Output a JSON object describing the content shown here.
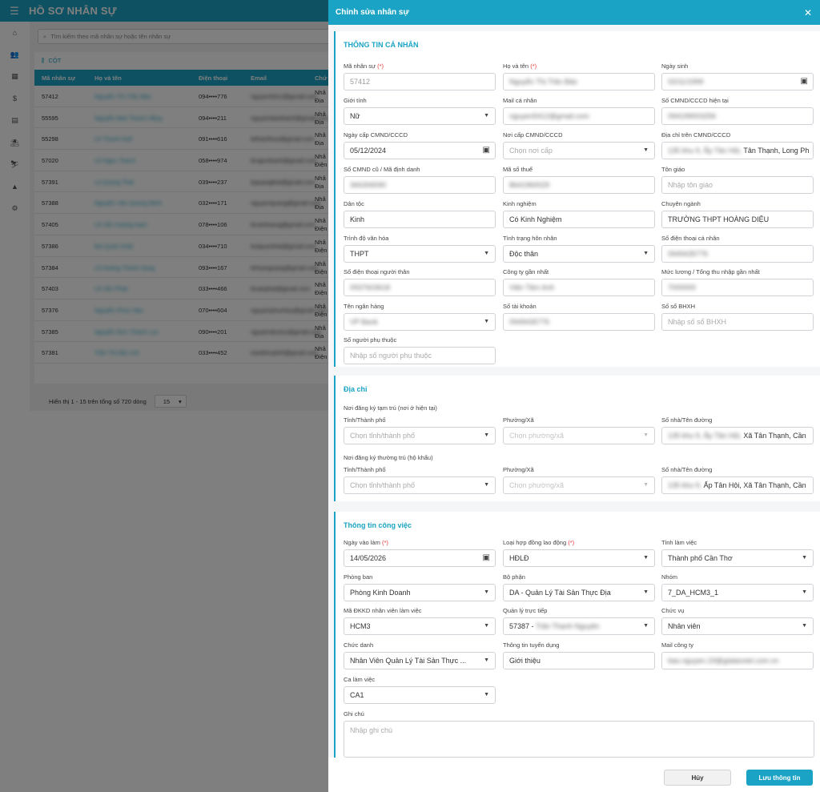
{
  "app": {
    "title": "HỒ SƠ NHÂN SỰ",
    "search_placeholder": "Tìm kiếm theo mã nhân sự hoặc tên nhân sự",
    "columns_button": "CỘT",
    "table": {
      "headers": [
        "Mã nhân sự",
        "Họ và tên",
        "Điện thoại",
        "Email",
        "Chứ"
      ],
      "rows": [
        {
          "code": "57412",
          "name": "Nguyễn Thị Trần Bảo",
          "phone": "094••••776",
          "email": "nguyen5412@gmail.com",
          "cat": [
            "Nhâ",
            "Địa"
          ]
        },
        {
          "code": "55595",
          "name": "Nguyễn Bảo Thanh Hằng",
          "phone": "094••••211",
          "email": "nguyenbaothanh@gmail.com",
          "cat": [
            "Nhâ",
            "Địa"
          ]
        },
        {
          "code": "55298",
          "name": "Lê Thanh Huệ",
          "phone": "091••••616",
          "email": "lethanhhue@gmail.com",
          "cat": [
            "Nhâ",
            "Địa"
          ]
        },
        {
          "code": "57020",
          "name": "Lê Ngọc Thanh",
          "phone": "058••••974",
          "email": "lengocthanh@gmail.com",
          "cat": [
            "Nhâ",
            "Điện"
          ]
        },
        {
          "code": "57391",
          "name": "Lý Quang Thái",
          "phone": "039••••237",
          "email": "lyquangthai@gmail.com",
          "cat": [
            "Nhâ",
            "Địa"
          ]
        },
        {
          "code": "57388",
          "name": "Nguyễn Văn Quang Minh",
          "phone": "032••••171",
          "email": "nguyenquang@gmail.com",
          "cat": [
            "Nhâ",
            "Địa"
          ]
        },
        {
          "code": "57405",
          "name": "Lê Văn Hoàng Nam",
          "phone": "078••••106",
          "email": "levanhoang@gmail.com",
          "cat": [
            "Nhâ",
            "Điện"
          ]
        },
        {
          "code": "57386",
          "name": "Bùi Quốc Khải",
          "phone": "034••••710",
          "email": "buiquockhai@gmail.com",
          "cat": [
            "Nhâ",
            "Điện"
          ]
        },
        {
          "code": "57384",
          "name": "Lê Hoàng Thanh Sang",
          "phone": "093••••167",
          "email": "lehoangsang@gmail.com",
          "cat": [
            "Nhâ",
            "Điện"
          ]
        },
        {
          "code": "57403",
          "name": "Lê Văn Phát",
          "phone": "033••••466",
          "email": "levanphat@gmail.com",
          "cat": [
            "Nhâ",
            "Điện"
          ]
        },
        {
          "code": "57376",
          "name": "Nguyễn Phúc Hậu",
          "phone": "070••••604",
          "email": "nguyenphuchau@gmail.com",
          "cat": [
            "Nhâ",
            "Điện"
          ]
        },
        {
          "code": "57385",
          "name": "Nguyễn Đức Thành Lực",
          "phone": "090••••201",
          "email": "nguyenducluc@gmail.com",
          "cat": [
            "Nhâ",
            "Địa"
          ]
        },
        {
          "code": "57381",
          "name": "Trần Thị Mỹ Linh",
          "phone": "033••••452",
          "email": "tranthimylinh@gmail.com",
          "cat": [
            "Nhâ",
            "Điện"
          ]
        }
      ]
    },
    "footer_text": "Hiển thị 1 - 15 trên tổng số 720 dòng",
    "page_size": "15"
  },
  "drawer": {
    "title": "Chỉnh sửa nhân sự",
    "personal": {
      "title": "THÔNG TIN CÁ NHÂN",
      "employee_code": {
        "label": "Mã nhân sự",
        "value": "57412"
      },
      "full_name": {
        "label": "Họ và tên",
        "value": "Nguyễn Thị Trần Bảo"
      },
      "birthday": {
        "label": "Ngày sinh",
        "value": "02/11/1999"
      },
      "gender": {
        "label": "Giới tính",
        "value": "Nữ"
      },
      "personal_mail": {
        "label": "Mail cá nhân",
        "value": "nguyen5412@gmail.com"
      },
      "id_current": {
        "label": "Số CMND/CCCD hiện tại",
        "value": "094199003256"
      },
      "id_issue_date": {
        "label": "Ngày cấp CMND/CCCD",
        "value": "05/12/2024"
      },
      "id_issue_place": {
        "label": "Nơi cấp CMND/CCCD",
        "placeholder": "Chọn nơi cấp"
      },
      "id_address": {
        "label": "Địa chỉ trên CMND/CCCD",
        "value_hidden": "135 khu 9, Ấp Tân Hội,",
        "value_visible": "Tân Thạnh, Long Ph"
      },
      "id_old": {
        "label": "Số CMND cũ / Mã định danh",
        "value": "366306590"
      },
      "tax_code": {
        "label": "Mã số thuế",
        "value": "8641960029"
      },
      "religion": {
        "label": "Tôn giáo",
        "placeholder": "Nhập tôn giáo"
      },
      "ethnicity": {
        "label": "Dân tộc",
        "value": "Kinh"
      },
      "experience": {
        "label": "Kinh nghiệm",
        "value": "Có Kinh Nghiệm"
      },
      "major": {
        "label": "Chuyên ngành",
        "value": "TRƯỜNG THPT HOÀNG DIỆU"
      },
      "education": {
        "label": "Trình độ văn hóa",
        "value": "THPT"
      },
      "marital": {
        "label": "Tình trạng hôn nhân",
        "value": "Độc thân"
      },
      "phone_personal": {
        "label": "Số điện thoại cá nhân",
        "value": "0949435776"
      },
      "phone_relative": {
        "label": "Số điện thoại người thân",
        "value": "0937603618"
      },
      "last_company": {
        "label": "Công ty gần nhất",
        "value": "Viện Tâm Anh"
      },
      "last_salary": {
        "label": "Mức lương / Tổng thu nhập gần nhất",
        "value": "7000000"
      },
      "bank_name": {
        "label": "Tên ngân hàng",
        "value": "VP Bank"
      },
      "bank_account": {
        "label": "Số tài khoản",
        "value": "0949435776"
      },
      "social_ins": {
        "label": "Số sổ BHXH",
        "placeholder": "Nhập số sổ BHXH"
      },
      "dependents": {
        "label": "Số người phụ thuộc",
        "placeholder": "Nhập số người phụ thuộc"
      }
    },
    "address": {
      "title": "Địa chỉ",
      "temp_title": "Nơi đăng ký tạm trú (nơi ở hiện tại)",
      "temp_province": {
        "label": "Tỉnh/Thành phố",
        "placeholder": "Chọn tỉnh/thành phố"
      },
      "temp_ward": {
        "label": "Phường/Xã",
        "placeholder": "Chọn phường/xã"
      },
      "temp_street": {
        "label": "Số nhà/Tên đường",
        "value_hidden": "135 khu 9, Ấp Tân Hội,",
        "value_visible": "Xã Tân Thạnh, Cần"
      },
      "perm_title": "Nơi đăng ký thường trú (hộ khẩu)",
      "perm_province": {
        "label": "Tỉnh/Thành phố",
        "placeholder": "Chọn tỉnh/thành phố"
      },
      "perm_ward": {
        "label": "Phường/Xã",
        "placeholder": "Chọn phường/xã"
      },
      "perm_street": {
        "label": "Số nhà/Tên đường",
        "value_hidden": "135 khu 9,",
        "value_visible": "Ấp Tân Hội, Xã Tân Thạnh, Cần"
      }
    },
    "work": {
      "title": "Thông tin công việc",
      "start_date": {
        "label": "Ngày vào làm",
        "value": "14/05/2026"
      },
      "contract_type": {
        "label": "Loại hợp đồng lao động",
        "value": "HĐLĐ"
      },
      "work_province": {
        "label": "Tỉnh làm việc",
        "value": "Thành phố Cần Thơ"
      },
      "department": {
        "label": "Phòng ban",
        "value": "Phòng Kinh Doanh"
      },
      "division": {
        "label": "Bộ phận",
        "value": "DA - Quản Lý Tài Sản Thực Địa"
      },
      "group": {
        "label": "Nhóm",
        "value": "7_DA_HCM3_1"
      },
      "branch_code": {
        "label": "Mã ĐKKD nhân viên làm việc",
        "value": "HCM3"
      },
      "manager": {
        "label": "Quản lý trực tiếp",
        "value_visible": "57387 -",
        "value_hidden": "Trần Thanh Nguyên"
      },
      "position": {
        "label": "Chức vụ",
        "value": "Nhân viên"
      },
      "job_title": {
        "label": "Chức danh",
        "value": "Nhân Viên Quản Lý Tài Sản Thực ..."
      },
      "recruit_info": {
        "label": "Thông tin tuyển dụng",
        "value": "Giới thiệu"
      },
      "work_mail": {
        "label": "Mail công ty",
        "value": "bao.nguyen.19@gialaoviet.com.vn"
      },
      "shift": {
        "label": "Ca làm việc",
        "value": "CA1"
      },
      "note": {
        "label": "Ghi chú",
        "placeholder": "Nhập ghi chú"
      }
    },
    "buttons": {
      "cancel": "Hủy",
      "save": "Lưu thông tin"
    },
    "required_mark": "(*)"
  }
}
